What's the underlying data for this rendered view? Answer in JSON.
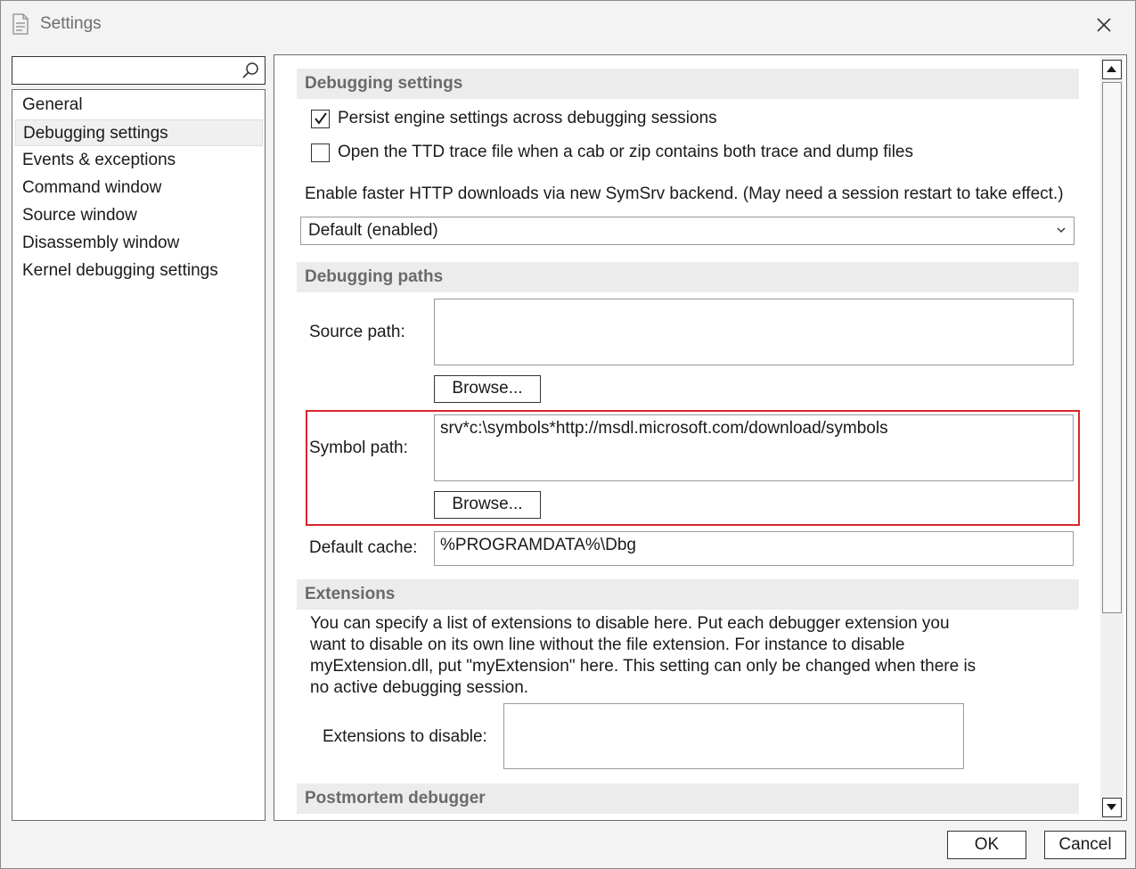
{
  "window": {
    "title": "Settings",
    "search": {
      "value": "",
      "placeholder": ""
    }
  },
  "sidebar": {
    "items": [
      {
        "label": "General"
      },
      {
        "label": "Debugging settings",
        "selected": true
      },
      {
        "label": "Events & exceptions"
      },
      {
        "label": "Command window"
      },
      {
        "label": "Source window"
      },
      {
        "label": "Disassembly window"
      },
      {
        "label": "Kernel debugging settings"
      }
    ]
  },
  "main": {
    "debugging_settings": {
      "header": "Debugging settings",
      "persist_checkbox": {
        "label": "Persist engine settings across debugging sessions",
        "checked": true
      },
      "ttd_checkbox": {
        "label": "Open the TTD trace file when a cab or zip contains both trace and dump files",
        "checked": false
      },
      "http_label": "Enable faster HTTP downloads via new SymSrv backend. (May need a session restart to take effect.)",
      "http_select_value": "Default (enabled)"
    },
    "debugging_paths": {
      "header": "Debugging paths",
      "source_path_label": "Source path:",
      "source_path_value": "",
      "browse_label": "Browse...",
      "symbol_path_label": "Symbol path:",
      "symbol_path_value": "srv*c:\\symbols*http://msdl.microsoft.com/download/symbols",
      "default_cache_label": "Default cache:",
      "default_cache_value": "%PROGRAMDATA%\\Dbg"
    },
    "extensions": {
      "header": "Extensions",
      "description": "You can specify a list of extensions to disable here. Put each debugger extension you want to disable on its own line without the file extension. For instance to disable myExtension.dll, put \"myExtension\" here. This setting can only be changed when there is no active debugging session.",
      "disable_label": "Extensions to disable:",
      "disable_value": ""
    },
    "postmortem": {
      "header": "Postmortem debugger"
    }
  },
  "footer": {
    "ok_label": "OK",
    "cancel_label": "Cancel"
  },
  "colors": {
    "highlight_border": "#d9262b",
    "section_header_bg": "#ececec"
  }
}
